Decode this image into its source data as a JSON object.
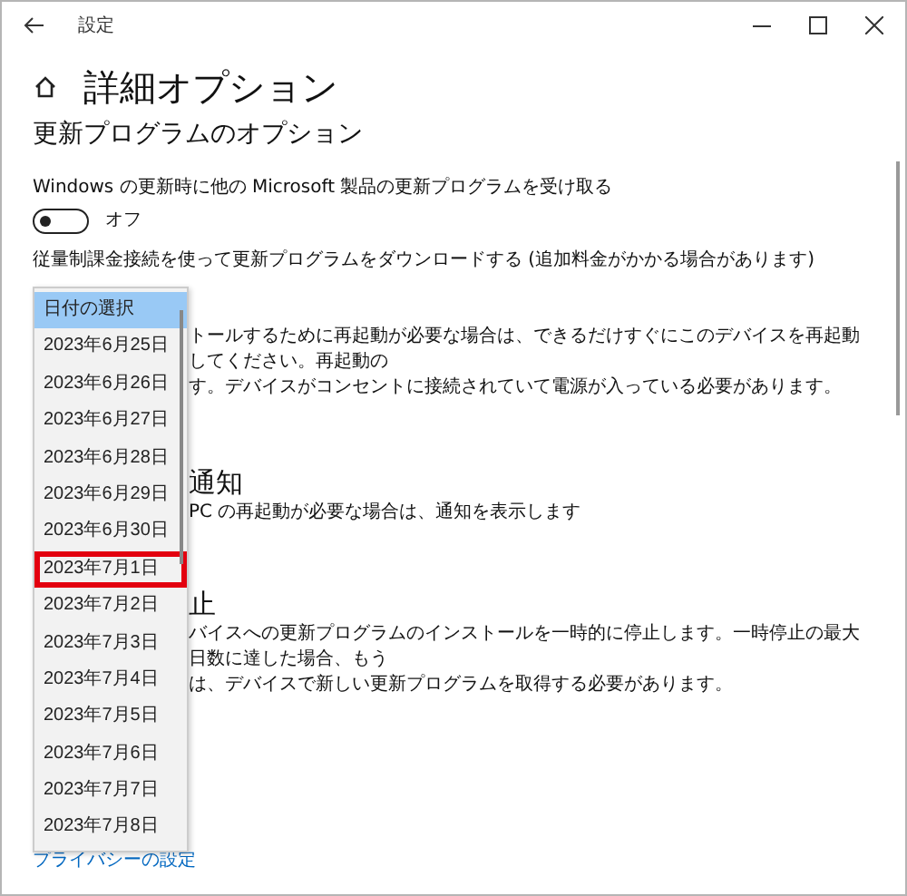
{
  "window": {
    "title": "設定"
  },
  "page_title": "詳細オプション",
  "section_title": "更新プログラムのオプション",
  "toggle_setting": {
    "label": "Windows の更新時に他の Microsoft 製品の更新プログラムを受け取る",
    "on": false,
    "state_label": "オフ"
  },
  "metered_label": "従量制課金接続を使って更新プログラムをダウンロードする (追加料金がかかる場合があります)",
  "date_dropdown": {
    "items": [
      {
        "label": "日付の選択",
        "selected": true,
        "outlined": false
      },
      {
        "label": "2023年6月25日",
        "selected": false,
        "outlined": false
      },
      {
        "label": "2023年6月26日",
        "selected": false,
        "outlined": false
      },
      {
        "label": "2023年6月27日",
        "selected": false,
        "outlined": false
      },
      {
        "label": "2023年6月28日",
        "selected": false,
        "outlined": false
      },
      {
        "label": "2023年6月29日",
        "selected": false,
        "outlined": false
      },
      {
        "label": "2023年6月30日",
        "selected": false,
        "outlined": false
      },
      {
        "label": "2023年7月1日",
        "selected": false,
        "outlined": true
      },
      {
        "label": "2023年7月2日",
        "selected": false,
        "outlined": false
      },
      {
        "label": "2023年7月3日",
        "selected": false,
        "outlined": false
      },
      {
        "label": "2023年7月4日",
        "selected": false,
        "outlined": false
      },
      {
        "label": "2023年7月5日",
        "selected": false,
        "outlined": false
      },
      {
        "label": "2023年7月6日",
        "selected": false,
        "outlined": false
      },
      {
        "label": "2023年7月7日",
        "selected": false,
        "outlined": false
      },
      {
        "label": "2023年7月8日",
        "selected": false,
        "outlined": false
      }
    ]
  },
  "restart_text": "トールするために再起動が必要な場合は、できるだけすぐにこのデバイスを再起動してください。再起動の",
  "restart_text_2": "す。デバイスがコンセントに接続されていて電源が入っている必要があります。",
  "notify_heading": "通知",
  "notify_text": "PC の再起動が必要な場合は、通知を表示します",
  "pause_heading": "止",
  "pause_text": "バイスへの更新プログラムのインストールを一時的に停止します。一時停止の最大日数に達した場合、もう",
  "pause_text_2": "は、デバイスで新しい更新プログラムを取得する必要があります。",
  "privacy_link": "プライバシーの設定"
}
